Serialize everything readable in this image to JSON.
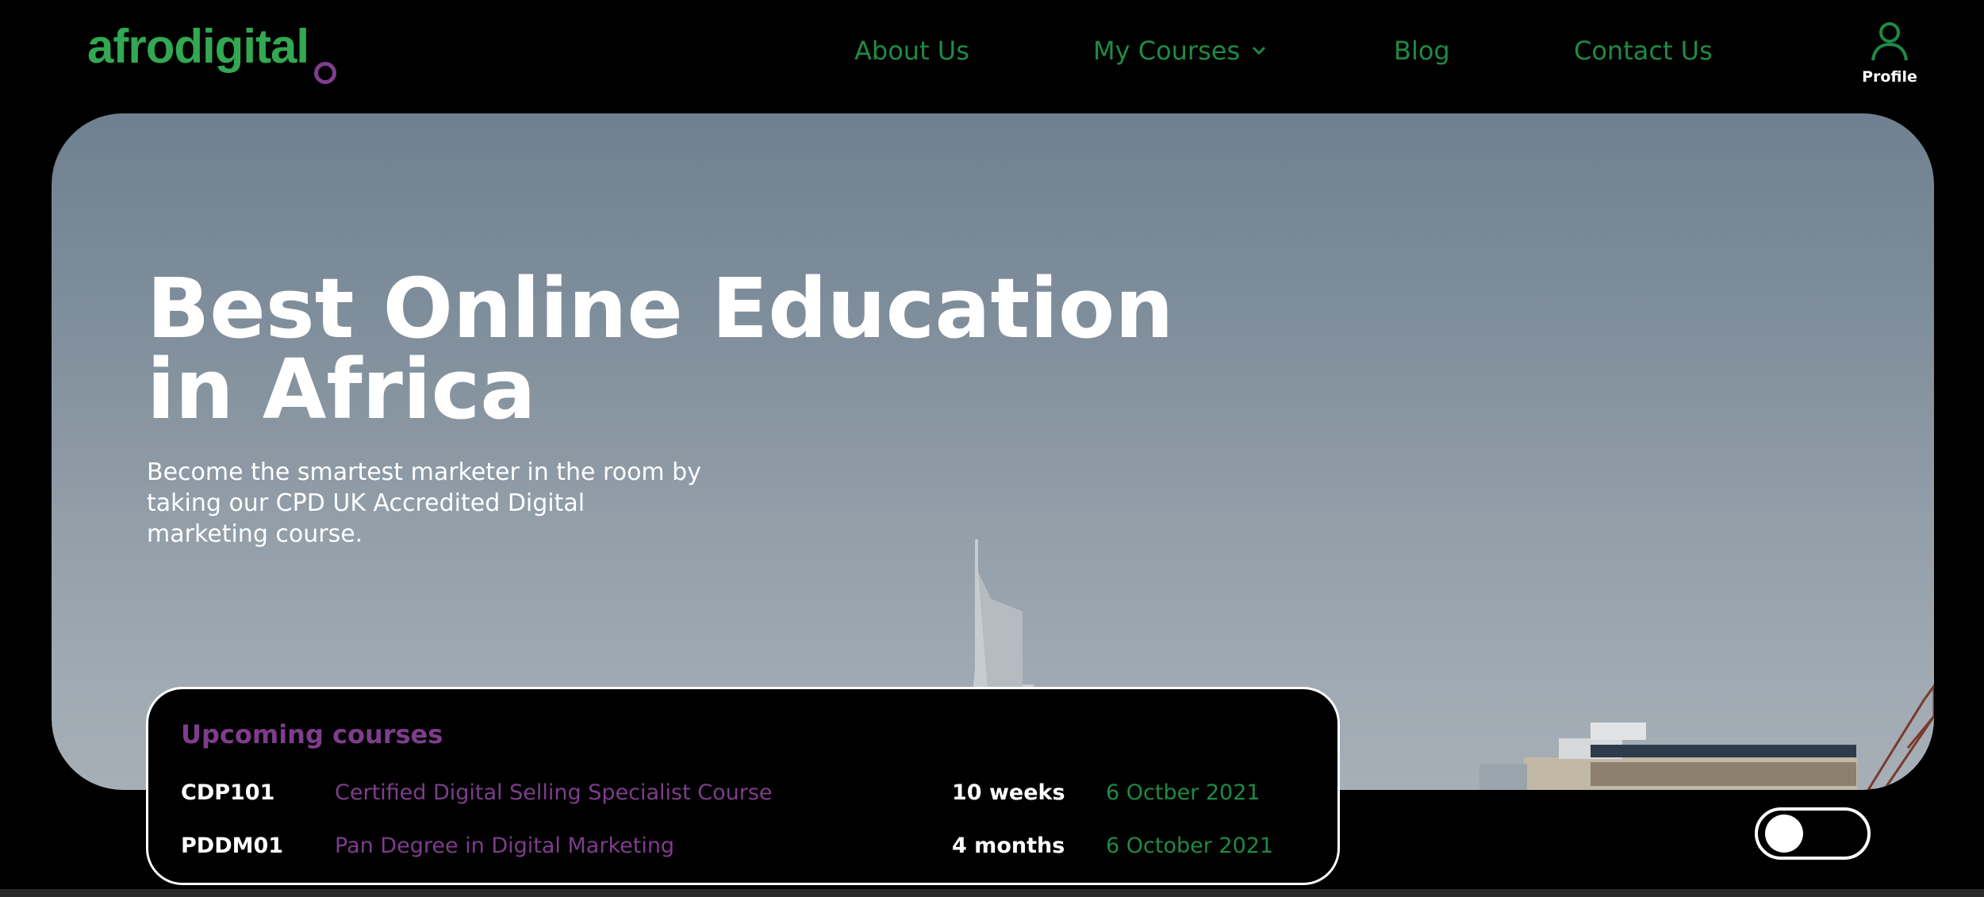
{
  "brand": {
    "logo_text": "afrodigital",
    "accent_green": "#32a852",
    "accent_purple": "#7e3d8c"
  },
  "nav": {
    "items": [
      {
        "label": "About Us"
      },
      {
        "label": "My Courses",
        "icon": "chevron-down-icon"
      },
      {
        "label": "Blog"
      },
      {
        "label": "Contact Us"
      }
    ],
    "profile": {
      "label": "Profile",
      "icon": "user-icon"
    }
  },
  "hero": {
    "title_line1": "Best Online Education",
    "title_line2": "in Africa",
    "subtitle": "Become the smartest marketer in the room by taking our CPD UK Accredited Digital marketing course."
  },
  "upcoming": {
    "title": "Upcoming courses",
    "courses": [
      {
        "code": "CDP101",
        "name": "Certified Digital Selling Specialist Course",
        "duration": "10 weeks",
        "date": "6 Octber 2021"
      },
      {
        "code": "PDDM01",
        "name": "Pan Degree in Digital Marketing",
        "duration": "4 months",
        "date": "6 October 2021"
      }
    ]
  },
  "theme_toggle": {
    "state": "off"
  }
}
